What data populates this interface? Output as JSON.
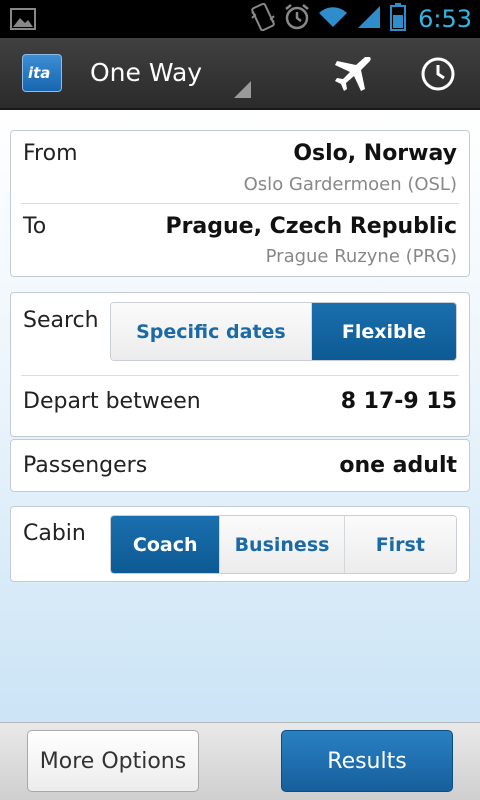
{
  "status_bar": {
    "time": "6:53",
    "icons": [
      "image-icon",
      "vibrate-icon",
      "alarm-icon",
      "wifi-icon",
      "signal-icon",
      "battery-icon"
    ],
    "time_color": "#33b5e5"
  },
  "action_bar": {
    "app_logo_text": "ita",
    "title": "One Way",
    "actions": [
      "airplane-icon",
      "clock-icon"
    ]
  },
  "route": {
    "from_label": "From",
    "from_city": "Oslo, Norway",
    "from_airport": "Oslo Gardermoen (OSL)",
    "to_label": "To",
    "to_city": "Prague, Czech Republic",
    "to_airport": "Prague Ruzyne (PRG)"
  },
  "dates": {
    "search_label": "Search",
    "options": [
      "Specific dates",
      "Flexible"
    ],
    "selected": "Flexible",
    "depart_label": "Depart between",
    "depart_value": "8 17-9 15"
  },
  "passengers": {
    "label": "Passengers",
    "value": "one adult"
  },
  "cabin": {
    "label": "Cabin",
    "options": [
      "Coach",
      "Business",
      "First"
    ],
    "selected": "Coach"
  },
  "bottom_bar": {
    "more_options": "More Options",
    "results": "Results"
  },
  "colors": {
    "accent": "#1766a6",
    "link_text": "#1b6aa5"
  }
}
